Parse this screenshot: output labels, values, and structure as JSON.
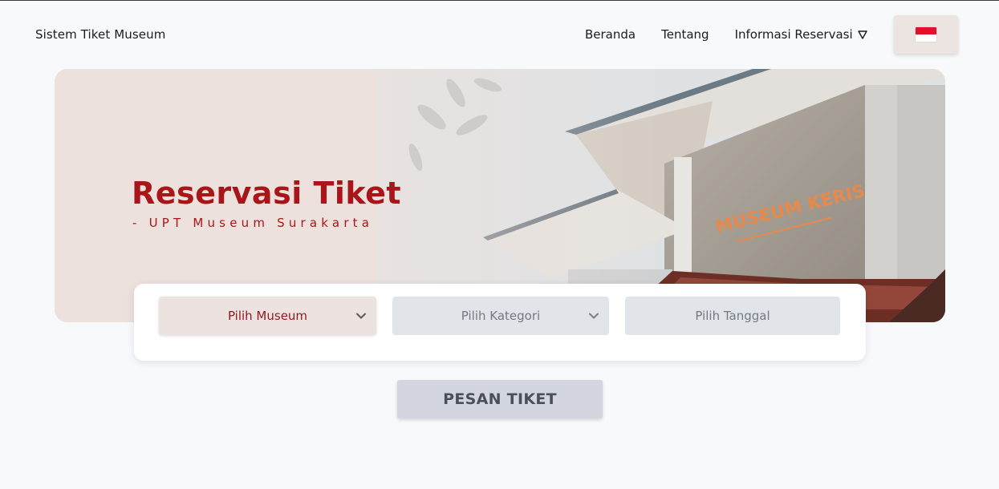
{
  "header": {
    "brand": "Sistem Tiket Museum",
    "nav": {
      "home": "Beranda",
      "about": "Tentang",
      "reservation_info": "Informasi Reservasi"
    },
    "language_flag": "indonesia-flag-icon"
  },
  "hero": {
    "title": "Reservasi Tiket",
    "subtitle": "- UPT Museum Surakarta",
    "building_sign": "MUSEUM KERIS"
  },
  "form": {
    "museum_select": "Pilih Museum",
    "category_select": "Pilih Kategori",
    "date_input": "Pilih Tanggal"
  },
  "actions": {
    "order_button": "PESAN TIKET"
  },
  "colors": {
    "accent": "#a8161a",
    "background": "#f8f9fb",
    "hero_bg": "#ede1dd",
    "field_inactive": "#e1e4e8",
    "button_bg": "#d3d6de"
  }
}
